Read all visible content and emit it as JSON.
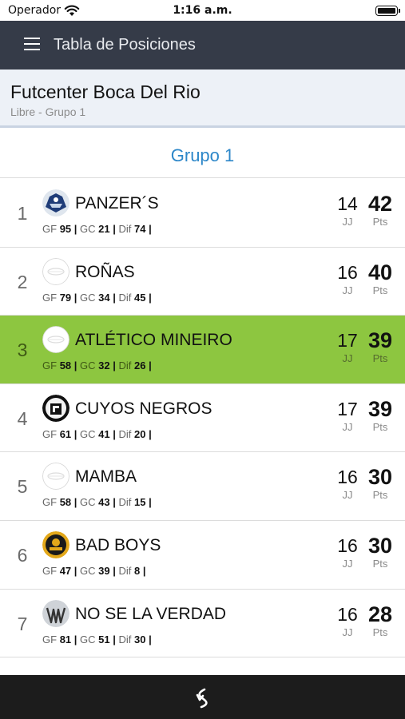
{
  "status": {
    "carrier": "Operador",
    "time": "1:16 a.m."
  },
  "nav": {
    "title": "Tabla de Posiciones",
    "menu_icon": "hamburger-menu-icon"
  },
  "venue": {
    "name": "Futcenter Boca Del Rio",
    "subtitle": "Libre - Grupo 1"
  },
  "group": {
    "title": "Grupo 1"
  },
  "labels": {
    "gf": "GF",
    "gc": "GC",
    "dif": "Dif",
    "jj": "JJ",
    "pts": "Pts",
    "sep": "|"
  },
  "colors": {
    "nav_bg": "#353b48",
    "accent": "#2d87c9",
    "highlight": "#8dc640",
    "bottom_bar": "#1c1c1c"
  },
  "standings": [
    {
      "pos": "1",
      "team": "PANZER´S",
      "gf": "95",
      "gc": "21",
      "dif": "74",
      "jj": "14",
      "pts": "42",
      "logo": "panzers-logo-icon",
      "highlight": false
    },
    {
      "pos": "2",
      "team": "ROÑAS",
      "gf": "79",
      "gc": "34",
      "dif": "45",
      "jj": "16",
      "pts": "40",
      "logo": "default-team-logo-icon",
      "highlight": false
    },
    {
      "pos": "3",
      "team": "ATLÉTICO MINEIRO",
      "gf": "58",
      "gc": "32",
      "dif": "26",
      "jj": "17",
      "pts": "39",
      "logo": "default-team-logo-icon",
      "highlight": true
    },
    {
      "pos": "4",
      "team": "CUYOS NEGROS",
      "gf": "61",
      "gc": "41",
      "dif": "20",
      "jj": "17",
      "pts": "39",
      "logo": "cuyos-negros-logo-icon",
      "highlight": false
    },
    {
      "pos": "5",
      "team": "MAMBA",
      "gf": "58",
      "gc": "43",
      "dif": "15",
      "jj": "16",
      "pts": "30",
      "logo": "default-team-logo-icon",
      "highlight": false
    },
    {
      "pos": "6",
      "team": "BAD BOYS",
      "gf": "47",
      "gc": "39",
      "dif": "8",
      "jj": "16",
      "pts": "30",
      "logo": "bad-boys-logo-icon",
      "highlight": false
    },
    {
      "pos": "7",
      "team": "NO SE LA VERDAD",
      "gf": "81",
      "gc": "51",
      "dif": "30",
      "jj": "16",
      "pts": "28",
      "logo": "no-se-la-verdad-logo-icon",
      "highlight": false
    }
  ],
  "bottom": {
    "back_icon": "back-arrow-icon"
  }
}
